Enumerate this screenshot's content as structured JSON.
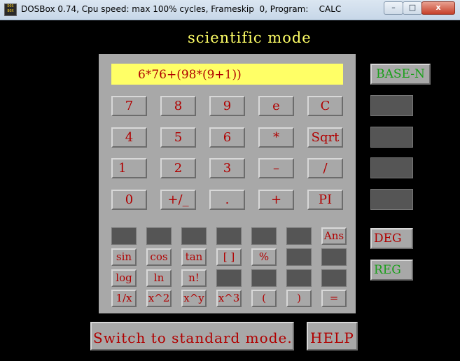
{
  "window": {
    "icon_text": "DOS BOX",
    "title": "DOSBox 0.74, Cpu speed: max 100% cycles, Frameskip  0, Program:    CALC",
    "minimize": "–",
    "maximize": "□",
    "close": "x"
  },
  "calculator": {
    "mode_title": "scientific  mode",
    "display": "6*76+(98*(9+1))",
    "digits_grid": {
      "row1": [
        "7",
        "8",
        "9",
        "e",
        "C"
      ],
      "row2": [
        "4",
        "5",
        "6",
        "*",
        "Sqrt"
      ],
      "row3": [
        "1",
        "2",
        "3",
        "–",
        "/"
      ],
      "row4": [
        "0",
        "+/_",
        ".",
        "+",
        "PI"
      ]
    },
    "sci": {
      "ans": "Ans",
      "row_trig": [
        "sin",
        "cos",
        "tan",
        "[ ]",
        "%"
      ],
      "row_log": [
        "log",
        "ln",
        "n!"
      ],
      "row_pow": [
        "1/x",
        "x^2",
        "x^y",
        "x^3",
        "(",
        ")",
        "="
      ]
    },
    "side": {
      "base_n": "BASE-N",
      "deg": "DEG",
      "reg": "REG"
    },
    "switch_mode": "Switch  to  standard  mode.",
    "help": "HELP"
  }
}
